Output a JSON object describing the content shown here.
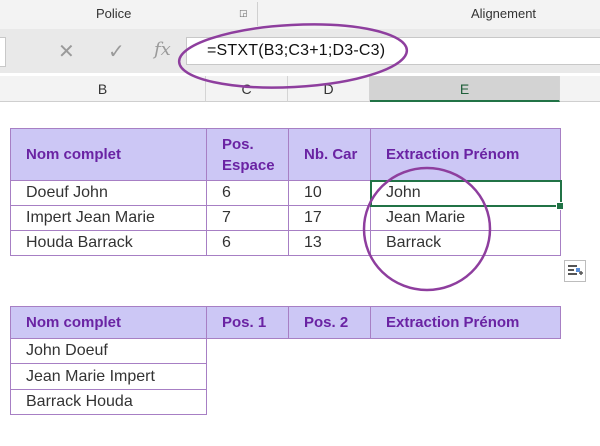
{
  "ribbon": {
    "groups": [
      "Police",
      "Alignement"
    ]
  },
  "formula_bar": {
    "cancel_symbol": "✕",
    "enter_symbol": "✓",
    "fx_symbol": "fx",
    "formula": "=STXT(B3;C3+1;D3-C3)"
  },
  "columns": [
    "B",
    "C",
    "D",
    "E"
  ],
  "active_column": "E",
  "table1": {
    "headers": [
      "Nom complet",
      "Pos. Espace",
      "Nb. Car",
      "Extraction Prénom"
    ],
    "header_c_lines": [
      "Pos.",
      "Espace"
    ],
    "rows": [
      [
        "Doeuf John",
        "6",
        "10",
        "John"
      ],
      [
        "Impert Jean Marie",
        "7",
        "17",
        "Jean Marie"
      ],
      [
        "Houda Barrack",
        "6",
        "13",
        "Barrack"
      ]
    ]
  },
  "table2": {
    "headers": [
      "Nom complet",
      "Pos. 1",
      "Pos. 2",
      "Extraction Prénom"
    ],
    "rows": [
      "John Doeuf",
      "Jean Marie Impert",
      "Barrack Houda"
    ]
  },
  "colors": {
    "accent_purple": "#8e3e9e",
    "header_fill": "#ccc7f5",
    "selection_green": "#217346"
  }
}
